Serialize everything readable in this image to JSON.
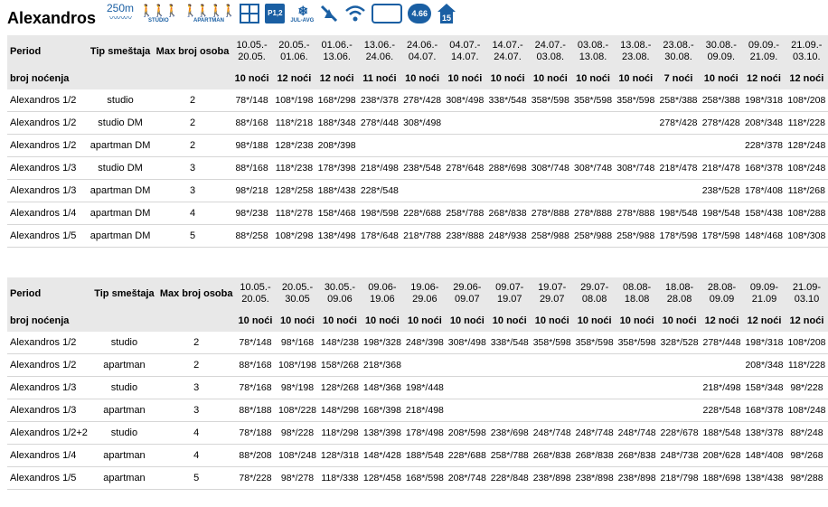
{
  "title": "Alexandros",
  "icons": [
    {
      "name": "beach-distance-icon",
      "label": "250m"
    },
    {
      "name": "studio-capacity-icon",
      "label": "STUDIO"
    },
    {
      "name": "apartment-capacity-icon",
      "label": "APARTMAN"
    },
    {
      "name": "window-icon",
      "label": ""
    },
    {
      "name": "parking-icon",
      "label": "P1,2"
    },
    {
      "name": "air-conditioning-icon",
      "label": "JUL-AVG"
    },
    {
      "name": "no-pets-icon",
      "label": ""
    },
    {
      "name": "wifi-icon",
      "label": ""
    },
    {
      "name": "tv-icon",
      "label": ""
    },
    {
      "name": "rating-icon",
      "label": "4.66"
    },
    {
      "name": "min-stay-icon",
      "label": "15"
    }
  ],
  "table1": {
    "headers": {
      "period": "Period",
      "tip": "Tip smeštaja",
      "max": "Max broj osoba"
    },
    "periods": [
      [
        "10.05.-",
        "20.05."
      ],
      [
        "20.05.-",
        "01.06."
      ],
      [
        "01.06.-",
        "13.06."
      ],
      [
        "13.06.-",
        "24.06."
      ],
      [
        "24.06.-",
        "04.07."
      ],
      [
        "04.07.-",
        "14.07."
      ],
      [
        "14.07.-",
        "24.07."
      ],
      [
        "24.07.-",
        "03.08."
      ],
      [
        "03.08.-",
        "13.08."
      ],
      [
        "13.08.-",
        "23.08."
      ],
      [
        "23.08.-",
        "30.08."
      ],
      [
        "30.08.-",
        "09.09."
      ],
      [
        "09.09.-",
        "21.09."
      ],
      [
        "21.09.-",
        "03.10."
      ]
    ],
    "nights_label": "broj noćenja",
    "nights": [
      "10 noći",
      "12 noći",
      "12 noći",
      "11 noći",
      "10 noći",
      "10 noći",
      "10 noći",
      "10 noći",
      "10 noći",
      "10 noći",
      "7 noći",
      "10 noći",
      "12 noći",
      "12 noći"
    ],
    "rows": [
      {
        "name": "Alexandros 1/2",
        "tip": "studio",
        "max": "2",
        "rates": [
          "78*/148",
          "108*/198",
          "168*/298",
          "238*/378",
          "278*/428",
          "308*/498",
          "338*/548",
          "358*/598",
          "358*/598",
          "358*/598",
          "258*/388",
          "258*/388",
          "198*/318",
          "108*/208"
        ]
      },
      {
        "name": "Alexandros 1/2",
        "tip": "studio DM",
        "max": "2",
        "rates": [
          "88*/168",
          "118*/218",
          "188*/348",
          "278*/448",
          "308*/498",
          "",
          "",
          "",
          "",
          "",
          "278*/428",
          "278*/428",
          "208*/348",
          "118*/228"
        ]
      },
      {
        "name": "Alexandros 1/2",
        "tip": "apartman DM",
        "max": "2",
        "rates": [
          "98*/188",
          "128*/238",
          "208*/398",
          "",
          "",
          "",
          "",
          "",
          "",
          "",
          "",
          "",
          "228*/378",
          "128*/248"
        ]
      },
      {
        "name": "Alexandros 1/3",
        "tip": "studio DM",
        "max": "3",
        "rates": [
          "88*/168",
          "118*/238",
          "178*/398",
          "218*/498",
          "238*/548",
          "278*/648",
          "288*/698",
          "308*/748",
          "308*/748",
          "308*/748",
          "218*/478",
          "218*/478",
          "168*/378",
          "108*/248"
        ]
      },
      {
        "name": "Alexandros 1/3",
        "tip": "apartman DM",
        "max": "3",
        "rates": [
          "98*/218",
          "128*/258",
          "188*/438",
          "228*/548",
          "",
          "",
          "",
          "",
          "",
          "",
          "",
          "238*/528",
          "178*/408",
          "118*/268"
        ]
      },
      {
        "name": "Alexandros 1/4",
        "tip": "apartman DM",
        "max": "4",
        "rates": [
          "98*/238",
          "118*/278",
          "158*/468",
          "198*/598",
          "228*/688",
          "258*/788",
          "268*/838",
          "278*/888",
          "278*/888",
          "278*/888",
          "198*/548",
          "198*/548",
          "158*/438",
          "108*/288"
        ]
      },
      {
        "name": "Alexandros 1/5",
        "tip": "apartman DM",
        "max": "5",
        "rates": [
          "88*/258",
          "108*/298",
          "138*/498",
          "178*/648",
          "218*/788",
          "238*/888",
          "248*/938",
          "258*/988",
          "258*/988",
          "258*/988",
          "178*/598",
          "178*/598",
          "148*/468",
          "108*/308"
        ]
      }
    ]
  },
  "table2": {
    "headers": {
      "period": "Period",
      "tip": "Tip smeštaja",
      "max": "Max broj osoba"
    },
    "periods": [
      [
        "10.05.-",
        "20.05."
      ],
      [
        "20.05.-",
        "30.05"
      ],
      [
        "30.05.-",
        "09.06"
      ],
      [
        "09.06-",
        "19.06"
      ],
      [
        "19.06-",
        "29.06"
      ],
      [
        "29.06-",
        "09.07"
      ],
      [
        "09.07-",
        "19.07"
      ],
      [
        "19.07-",
        "29.07"
      ],
      [
        "29.07-",
        "08.08"
      ],
      [
        "08.08-",
        "18.08"
      ],
      [
        "18.08-",
        "28.08"
      ],
      [
        "28.08-",
        "09.09"
      ],
      [
        "09.09-",
        "21.09"
      ],
      [
        "21.09-",
        "03.10"
      ]
    ],
    "nights_label": "broj noćenja",
    "nights": [
      "10 noći",
      "10 noći",
      "10 noći",
      "10 noći",
      "10 noći",
      "10 noći",
      "10 noći",
      "10 noći",
      "10 noći",
      "10 noći",
      "10 noći",
      "12 noći",
      "12 noći",
      "12 noći"
    ],
    "rows": [
      {
        "name": "Alexandros 1/2",
        "tip": "studio",
        "max": "2",
        "rates": [
          "78*/148",
          "98*/168",
          "148*/238",
          "198*/328",
          "248*/398",
          "308*/498",
          "338*/548",
          "358*/598",
          "358*/598",
          "358*/598",
          "328*/528",
          "278*/448",
          "198*/318",
          "108*/208"
        ]
      },
      {
        "name": "Alexandros 1/2",
        "tip": "apartman",
        "max": "2",
        "rates": [
          "88*/168",
          "108*/198",
          "158*/268",
          "218*/368",
          "",
          "",
          "",
          "",
          "",
          "",
          "",
          "",
          "208*/348",
          "118*/228"
        ]
      },
      {
        "name": "Alexandros 1/3",
        "tip": "studio",
        "max": "3",
        "rates": [
          "78*/168",
          "98*/198",
          "128*/268",
          "148*/368",
          "198*/448",
          "",
          "",
          "",
          "",
          "",
          "",
          "218*/498",
          "158*/348",
          "98*/228"
        ]
      },
      {
        "name": "Alexandros 1/3",
        "tip": "apartman",
        "max": "3",
        "rates": [
          "88*/188",
          "108*/228",
          "148*/298",
          "168*/398",
          "218*/498",
          "",
          "",
          "",
          "",
          "",
          "",
          "228*/548",
          "168*/378",
          "108*/248"
        ]
      },
      {
        "name": "Alexandros 1/2+2",
        "tip": "studio",
        "max": "4",
        "rates": [
          "78*/188",
          "98*/228",
          "118*/298",
          "138*/398",
          "178*/498",
          "208*/598",
          "238*/698",
          "248*/748",
          "248*/748",
          "248*/748",
          "228*/678",
          "188*/548",
          "138*/378",
          "88*/248"
        ]
      },
      {
        "name": "Alexandros 1/4",
        "tip": "apartman",
        "max": "4",
        "rates": [
          "88*/208",
          "108*/248",
          "128*/318",
          "148*/428",
          "188*/548",
          "228*/688",
          "258*/788",
          "268*/838",
          "268*/838",
          "268*/838",
          "248*/738",
          "208*/628",
          "148*/408",
          "98*/268"
        ]
      },
      {
        "name": "Alexandros 1/5",
        "tip": "apartman",
        "max": "5",
        "rates": [
          "78*/228",
          "98*/278",
          "118*/338",
          "128*/458",
          "168*/598",
          "208*/748",
          "228*/848",
          "238*/898",
          "238*/898",
          "238*/898",
          "218*/798",
          "188*/698",
          "138*/438",
          "98*/288"
        ]
      }
    ]
  }
}
